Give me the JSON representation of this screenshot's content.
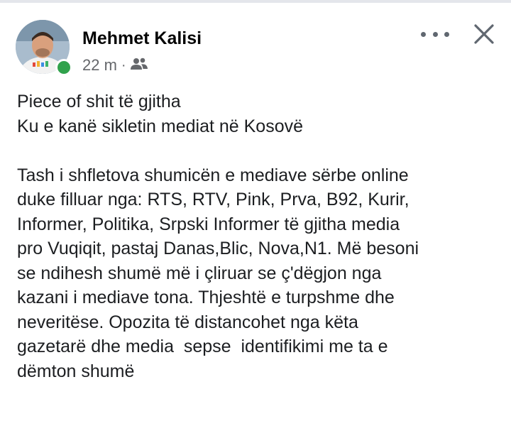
{
  "post": {
    "author": "Mehmet Kalisi",
    "time": "22 m",
    "separator": "·",
    "audience_icon": "friends-icon",
    "more_icon": "more-options-icon",
    "close_icon": "close-icon",
    "online_status_color": "#31a24c",
    "lines_block1": [
      "Piece of shit të gjitha",
      "Ku e kanë sikletin mediat në Kosovë"
    ],
    "lines_block2": [
      "Tash i shfletova shumicën e mediave sërbe online",
      "duke filluar nga: RTS, RTV, Pink, Prva, B92, Kurir,",
      "Informer, Politika, Srpski Informer të gjitha media",
      "pro Vuqiqit, pastaj Danas,Blic, Nova,N1. Më besoni",
      "se ndihesh shumë më i çliruar se ç'dëgjon nga",
      "kazani i mediave tona. Thjeshtë e turpshme dhe",
      "neveritëse. Opozita të distancohet nga këta",
      "gazetarë dhe media  sepse  identifikimi me ta e",
      "dëmton shumë"
    ]
  }
}
